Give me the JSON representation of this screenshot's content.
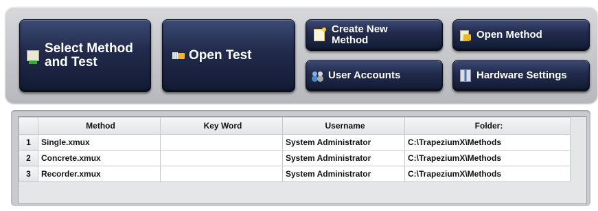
{
  "toolbar": {
    "select_method_label": "Select Method\nand Test",
    "open_test_label": "Open Test",
    "create_new_method_label": "Create New\nMethod",
    "open_method_label": "Open Method",
    "user_accounts_label": "User Accounts",
    "hardware_settings_label": "Hardware Settings",
    "icons": [
      "select-method-icon",
      "open-test-icon",
      "new-method-icon",
      "open-method-icon",
      "users-icon",
      "hardware-icon"
    ]
  },
  "table": {
    "columns": [
      "Method",
      "Key Word",
      "Username",
      "Folder:"
    ],
    "rows": [
      {
        "num": "1",
        "method": "Single.xmux",
        "keyword": "",
        "username": "System Administrator",
        "folder": "C:\\TrapeziumX\\Methods"
      },
      {
        "num": "2",
        "method": "Concrete.xmux",
        "keyword": "",
        "username": "System Administrator",
        "folder": "C:\\TrapeziumX\\Methods"
      },
      {
        "num": "3",
        "method": "Recorder.xmux",
        "keyword": "",
        "username": "System Administrator",
        "folder": "C:\\TrapeziumX\\Methods"
      }
    ]
  },
  "colors": {
    "button_dark": "#1b2440",
    "panel_gray": "#c4c6c9",
    "text_white": "#ffffff"
  }
}
